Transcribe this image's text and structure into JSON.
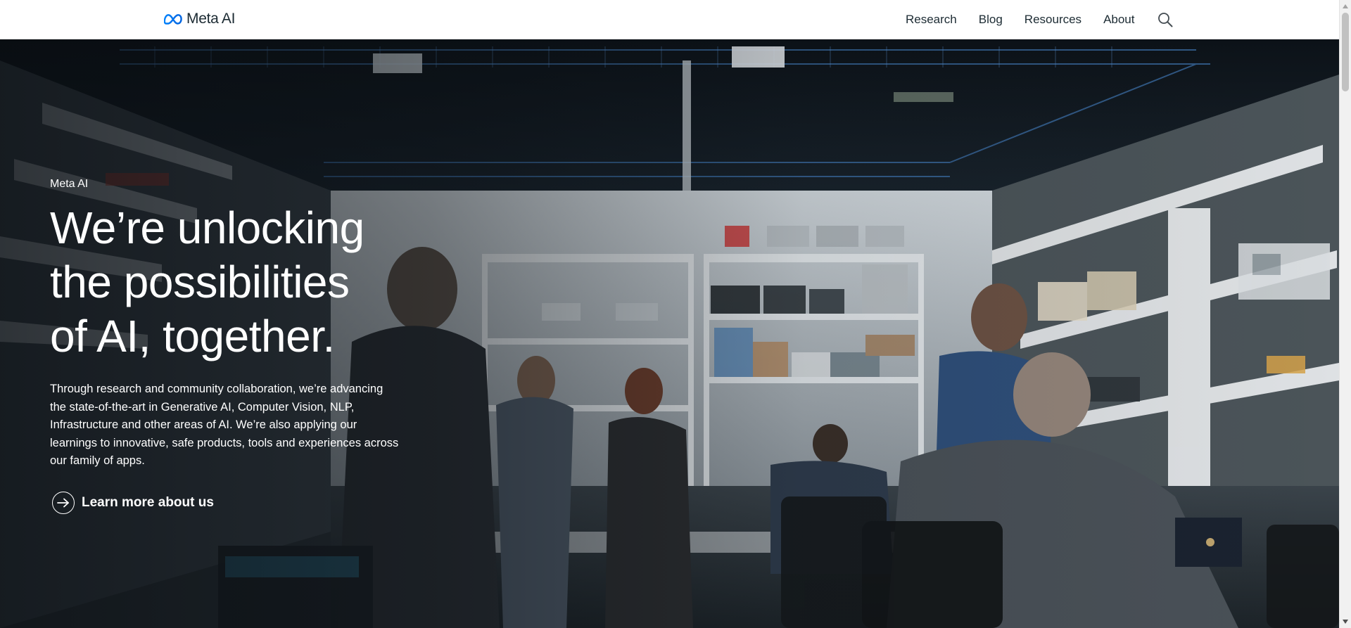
{
  "header": {
    "logo_text": "Meta AI",
    "nav": [
      {
        "label": "Research"
      },
      {
        "label": "Blog"
      },
      {
        "label": "Resources"
      },
      {
        "label": "About"
      }
    ],
    "search_icon": "search-icon"
  },
  "hero": {
    "eyebrow": "Meta AI",
    "headline": [
      "We’re unlocking",
      "the possibilities",
      "of AI, together."
    ],
    "description": "Through research and community collaboration, we’re advancing the state-of-the-art in Generative AI, Computer Vision, NLP, Infrastructure and other areas of AI. We’re also applying our learnings to innovative, safe products, tools and experiences across our family of apps.",
    "cta_label": "Learn more about us",
    "cta_icon": "arrow-right-icon"
  },
  "colors": {
    "brand_blue": "#0668E1",
    "nav_text": "#1c2b33",
    "hero_text": "#ffffff"
  }
}
